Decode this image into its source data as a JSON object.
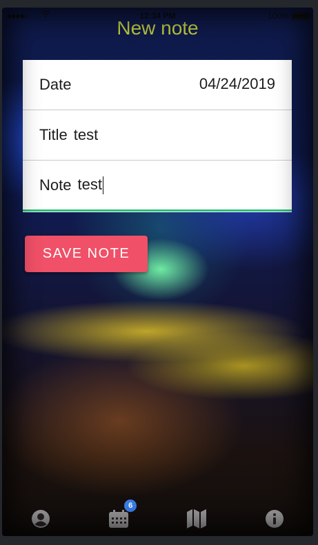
{
  "status_bar": {
    "signal": "●●●●○",
    "wifi_icon": "wifi-icon",
    "time": "12:34 PM",
    "battery": "100%"
  },
  "header": {
    "title": "New note"
  },
  "form": {
    "date_label": "Date",
    "date_value": "04/24/2019",
    "title_label": "Title",
    "title_value": "test",
    "note_label": "Note",
    "note_value": "test"
  },
  "actions": {
    "save_label": "SAVE NOTE"
  },
  "tab_bar": {
    "items": [
      {
        "icon": "user-icon"
      },
      {
        "icon": "calendar-icon",
        "badge": "6"
      },
      {
        "icon": "map-icon"
      },
      {
        "icon": "info-icon"
      }
    ]
  },
  "colors": {
    "title": "#c2cf3e",
    "save_button": "#f05068",
    "focus_underline": "#2dbf7a",
    "badge": "#3a7ee8",
    "tab_icons": "#9a9a9a"
  }
}
